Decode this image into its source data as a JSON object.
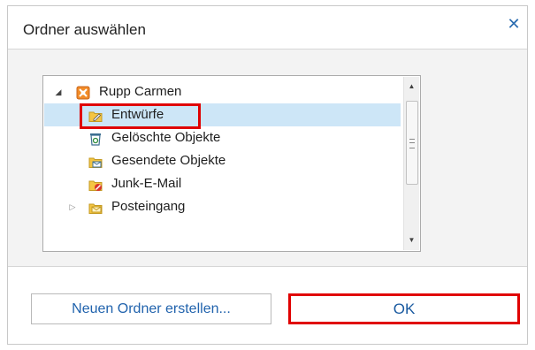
{
  "dialog": {
    "title": "Ordner auswählen",
    "close_glyph": "✕"
  },
  "tree": {
    "root": {
      "label": "Rupp Carmen",
      "icon": "mailbox-icon",
      "expanded": true
    },
    "items": [
      {
        "label": "Entwürfe",
        "icon": "drafts-folder-icon",
        "selected": true,
        "highlighted": true
      },
      {
        "label": "Gelöschte Objekte",
        "icon": "deleted-items-icon"
      },
      {
        "label": "Gesendete Objekte",
        "icon": "sent-items-icon"
      },
      {
        "label": "Junk-E-Mail",
        "icon": "junk-folder-icon"
      },
      {
        "label": "Posteingang",
        "icon": "inbox-folder-icon",
        "expandable": true
      }
    ]
  },
  "buttons": {
    "new_folder": "Neuen Ordner erstellen...",
    "ok": "OK"
  },
  "colors": {
    "accent": "#2b6cb0",
    "highlight_red": "#e00000",
    "selection": "#cde6f7",
    "folder_yellow": "#f5c542"
  }
}
